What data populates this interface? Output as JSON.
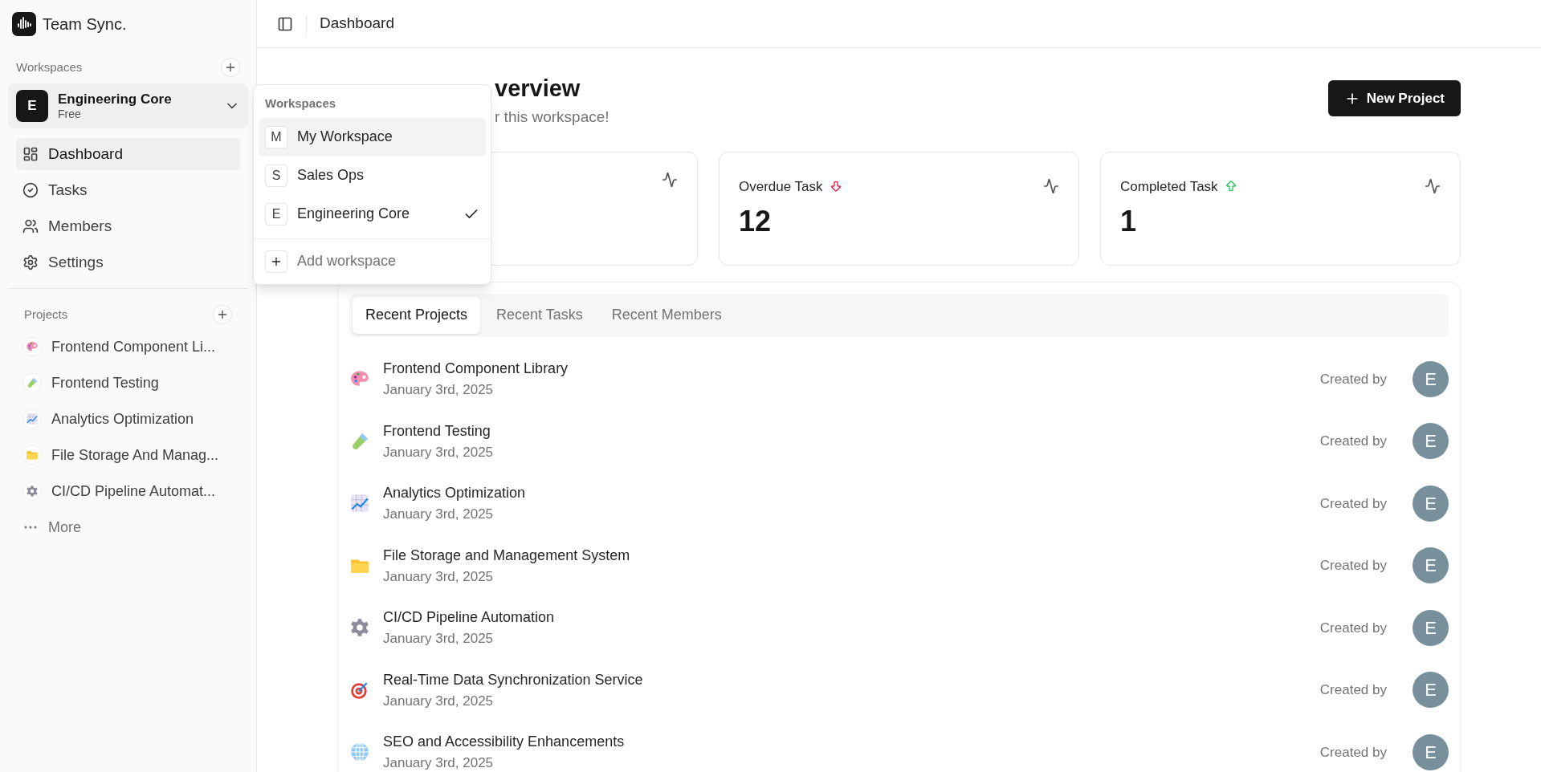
{
  "app": {
    "name": "Team Sync."
  },
  "header": {
    "title": "Dashboard"
  },
  "sidebar": {
    "workspaces_label": "Workspaces",
    "current_workspace": {
      "initial": "E",
      "name": "Engineering Core",
      "plan": "Free"
    },
    "nav": [
      {
        "kind": "dashboard",
        "label": "Dashboard",
        "selected": true
      },
      {
        "kind": "tasks",
        "label": "Tasks",
        "selected": false
      },
      {
        "kind": "members",
        "label": "Members",
        "selected": false
      },
      {
        "kind": "settings",
        "label": "Settings",
        "selected": false
      }
    ],
    "projects_label": "Projects",
    "projects": [
      {
        "kind": "palette",
        "name": "Frontend Component Li..."
      },
      {
        "kind": "tube",
        "name": "Frontend Testing"
      },
      {
        "kind": "chart",
        "name": "Analytics Optimization"
      },
      {
        "kind": "folder",
        "name": "File Storage And Manag..."
      },
      {
        "kind": "gear",
        "name": "CI/CD Pipeline Automat..."
      }
    ],
    "more": "More"
  },
  "workspace_menu": {
    "label": "Workspaces",
    "items": [
      {
        "initial": "M",
        "name": "My Workspace",
        "hovered": true,
        "selected": false
      },
      {
        "initial": "S",
        "name": "Sales Ops",
        "hovered": false,
        "selected": false
      },
      {
        "initial": "E",
        "name": "Engineering Core",
        "hovered": false,
        "selected": true
      }
    ],
    "add": "Add workspace"
  },
  "overview": {
    "title_end": "verview",
    "subtitle": "r this workspace!",
    "new_project": "New Project"
  },
  "stats": [
    {
      "title": "Overdue Task",
      "kind": "down",
      "value": "12"
    },
    {
      "title": "Completed Task",
      "kind": "up",
      "value": "1"
    }
  ],
  "tabs": [
    {
      "label": "Recent Projects",
      "selected": true
    },
    {
      "label": "Recent Tasks",
      "selected": false
    },
    {
      "label": "Recent Members",
      "selected": false
    }
  ],
  "projects": [
    {
      "kind": "palette",
      "name": "Frontend Component Library",
      "date": "January 3rd, 2025",
      "created_by": "Created by",
      "avatar": "E"
    },
    {
      "kind": "tube",
      "name": "Frontend Testing",
      "date": "January 3rd, 2025",
      "created_by": "Created by",
      "avatar": "E"
    },
    {
      "kind": "chart",
      "name": "Analytics Optimization",
      "date": "January 3rd, 2025",
      "created_by": "Created by",
      "avatar": "E"
    },
    {
      "kind": "folder",
      "name": "File Storage and Management System",
      "date": "January 3rd, 2025",
      "created_by": "Created by",
      "avatar": "E"
    },
    {
      "kind": "gear",
      "name": "CI/CD Pipeline Automation",
      "date": "January 3rd, 2025",
      "created_by": "Created by",
      "avatar": "E"
    },
    {
      "kind": "target",
      "name": "Real-Time Data Synchronization Service",
      "date": "January 3rd, 2025",
      "created_by": "Created by",
      "avatar": "E"
    },
    {
      "kind": "globe",
      "name": "SEO and Accessibility Enhancements",
      "date": "January 3rd, 2025",
      "created_by": "Created by",
      "avatar": "E"
    }
  ]
}
